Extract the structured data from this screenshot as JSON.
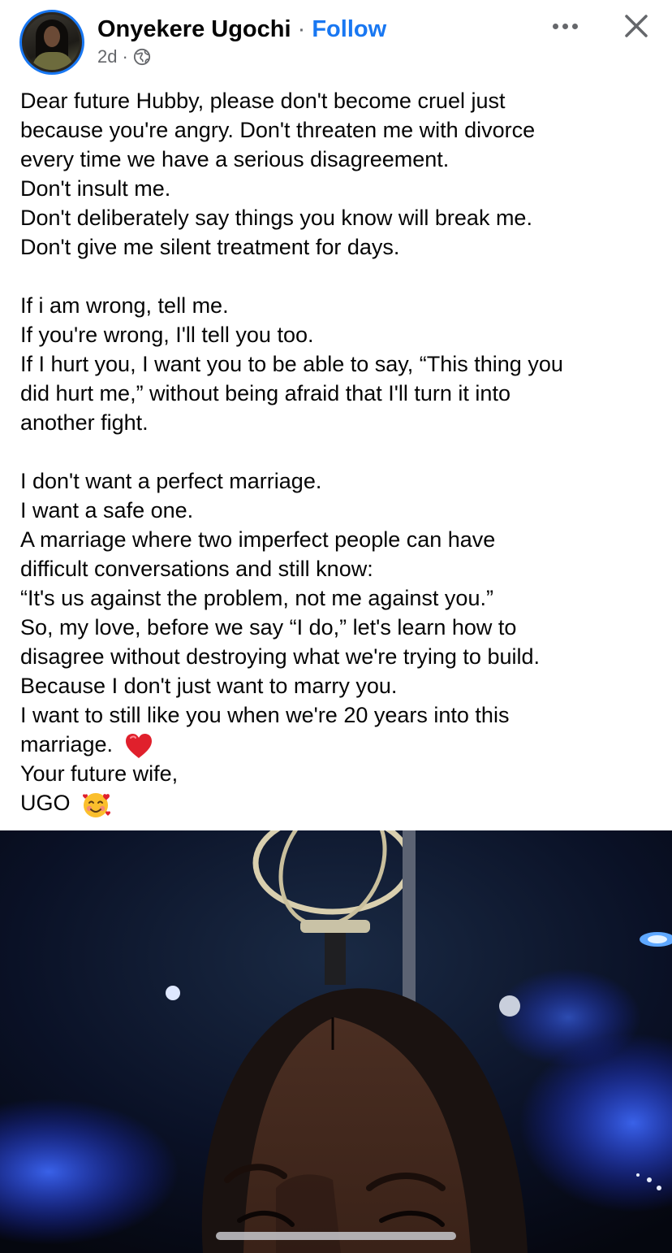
{
  "post": {
    "author": "Onyekere Ugochi",
    "separator": "·",
    "follow_label": "Follow",
    "time": "2d",
    "meta_separator": "·",
    "privacy_icon": "globe-icon",
    "more_icon": "more-horizontal-icon",
    "close_icon": "close-icon",
    "text_lines": [
      "Dear future Hubby, please don't become cruel just",
      "because you're angry. Don't threaten me with divorce",
      "every time we have a serious disagreement.",
      "Don't insult me.",
      "Don't deliberately say things you know will break me.",
      "Don't give me silent treatment for days.",
      "",
      "If i am  wrong, tell me.",
      "If you're wrong, I'll tell you too.",
      "If I hurt you, I want you to be able to say, “This thing you",
      "did hurt me,” without being afraid that I'll turn it into",
      "another fight.",
      "",
      "I don't want a perfect marriage.",
      "I want a safe one.",
      "A marriage where two imperfect people can have",
      "difficult conversations and still know:",
      "“It's us against the problem, not me against you.”",
      "So, my love, before we say “I do,” let's learn how to",
      "disagree without destroying what we're trying to build.",
      "Because I don't just want to marry you.",
      "I want to still like you when we're 20 years into this",
      "marriage.",
      "Your future wife,",
      "UGO"
    ],
    "emoji_heart": "red-heart-emoji",
    "emoji_face": "smiling-face-with-hearts-emoji"
  },
  "colors": {
    "accent": "#1877f2",
    "secondary_text": "#65676b",
    "primary_text": "#050505"
  }
}
